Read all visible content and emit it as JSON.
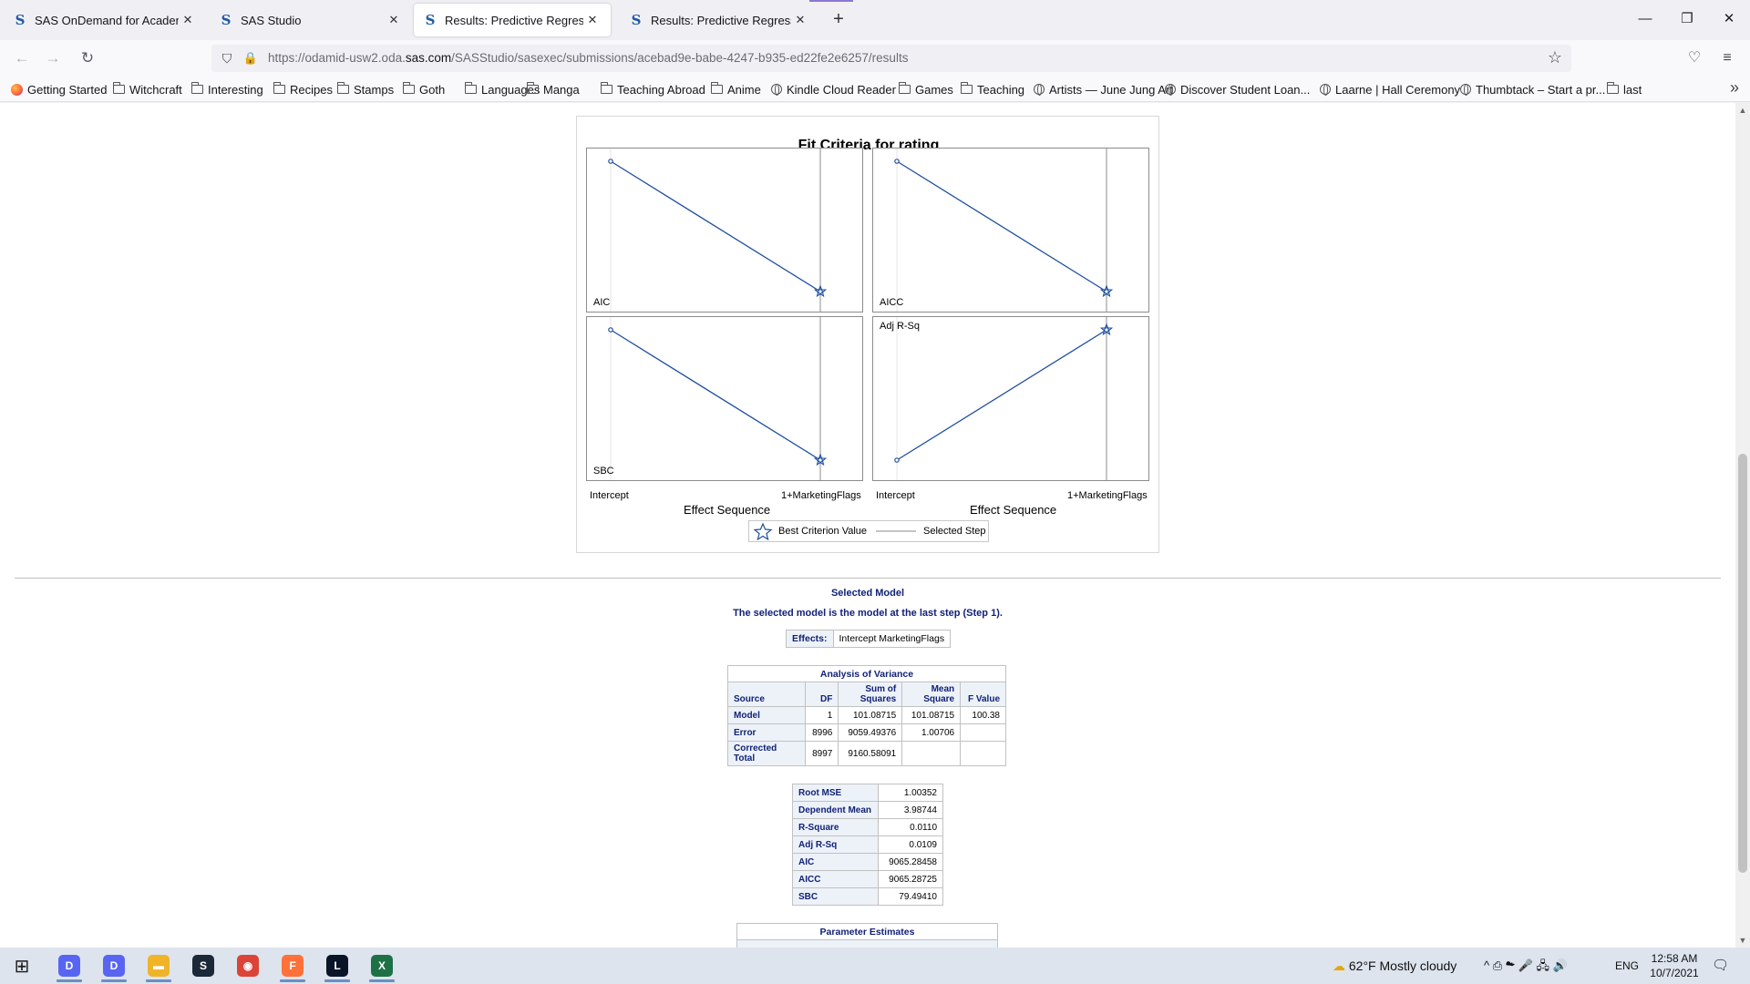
{
  "browser": {
    "tabs": [
      {
        "title": "SAS OnDemand for Academics",
        "close": "✕"
      },
      {
        "title": "SAS Studio",
        "close": "✕"
      },
      {
        "title": "Results: Predictive Regression M",
        "close": "✕"
      },
      {
        "title": "Results: Predictive Regression M",
        "close": "✕"
      }
    ],
    "favicon_glyph": "S",
    "new_tab": "+",
    "window_controls": {
      "minimize": "—",
      "restore": "❐",
      "close": "✕"
    },
    "url_host_prefix": "https://odamid-usw2.oda.",
    "url_host": "sas.com",
    "url_path": "/SASStudio/sasexec/submissions/acebad9e-babe-4247-b935-ed22fe2e6257/results",
    "nav_icons": {
      "back": "←",
      "forward": "→",
      "reload": "↻",
      "shield": "⛉",
      "lock": "🔒",
      "star": "☆",
      "pocket": "♡",
      "menu": "≡"
    },
    "bookmarks": [
      {
        "label": "Getting Started",
        "icon": "firefox-icon"
      },
      {
        "label": "Witchcraft",
        "icon": "folder-icon"
      },
      {
        "label": "Interesting",
        "icon": "folder-icon"
      },
      {
        "label": "Recipes",
        "icon": "folder-icon"
      },
      {
        "label": "Stamps",
        "icon": "folder-icon"
      },
      {
        "label": "Goth",
        "icon": "folder-icon"
      },
      {
        "label": "Languages",
        "icon": "folder-icon"
      },
      {
        "label": "Manga",
        "icon": "folder-icon"
      },
      {
        "label": "Teaching Abroad",
        "icon": "folder-icon"
      },
      {
        "label": "Anime",
        "icon": "folder-icon"
      },
      {
        "label": "Kindle Cloud Reader",
        "icon": "globe-icon"
      },
      {
        "label": "Games",
        "icon": "folder-icon"
      },
      {
        "label": "Teaching",
        "icon": "folder-icon"
      },
      {
        "label": "Artists — June Jung Art",
        "icon": "globe-icon"
      },
      {
        "label": "Discover Student Loan...",
        "icon": "globe-icon"
      },
      {
        "label": "Laarne | Hall Ceremony",
        "icon": "globe-icon"
      },
      {
        "label": "Thumbtack – Start a pr...",
        "icon": "globe-icon"
      },
      {
        "label": "last",
        "icon": "folder-icon"
      }
    ],
    "bookmarks_more": "»"
  },
  "figure": {
    "title": "Fit Criteria for rating",
    "x_label": "Effect Sequence",
    "x_ticks": [
      "Intercept",
      "1+MarketingFlags"
    ],
    "legend": {
      "best": "Best Criterion Value",
      "selected": "Selected Step"
    },
    "line_color": "#1f4f9f"
  },
  "chart_data": {
    "type": "line",
    "title": "Fit Criteria for rating",
    "xlabel": "Effect Sequence",
    "categories": [
      "Intercept",
      "1+MarketingFlags"
    ],
    "selected_step": "1+MarketingFlags",
    "series": [
      {
        "name": "AIC",
        "trend": "decreasing",
        "best_at": "1+MarketingFlags"
      },
      {
        "name": "AICC",
        "trend": "decreasing",
        "best_at": "1+MarketingFlags"
      },
      {
        "name": "SBC",
        "trend": "decreasing",
        "best_at": "1+MarketingFlags"
      },
      {
        "name": "Adj R-Sq",
        "trend": "increasing",
        "best_at": "1+MarketingFlags"
      }
    ],
    "panels": [
      {
        "label": "AIC",
        "start": "high",
        "end": "low"
      },
      {
        "label": "AICC",
        "start": "high",
        "end": "low"
      },
      {
        "label": "SBC",
        "start": "high",
        "end": "low"
      },
      {
        "label": "Adj R-Sq",
        "start": "low",
        "end": "high"
      }
    ]
  },
  "selected_model": {
    "title": "Selected Model",
    "subtitle": "The selected model is the model at the last step (Step 1).",
    "effects_label": "Effects:",
    "effects_value": "Intercept MarketingFlags"
  },
  "anova": {
    "caption": "Analysis of Variance",
    "headers": [
      "Source",
      "DF",
      "Sum of\nSquares",
      "Mean\nSquare",
      "F Value"
    ],
    "rows": [
      [
        "Model",
        "1",
        "101.08715",
        "101.08715",
        "100.38"
      ],
      [
        "Error",
        "8996",
        "9059.49376",
        "1.00706",
        ""
      ],
      [
        "Corrected Total",
        "8997",
        "9160.58091",
        "",
        ""
      ]
    ]
  },
  "fit_stats": [
    [
      "Root MSE",
      "1.00352"
    ],
    [
      "Dependent Mean",
      "3.98744"
    ],
    [
      "R-Square",
      "0.0110"
    ],
    [
      "Adj R-Sq",
      "0.0109"
    ],
    [
      "AIC",
      "9065.28458"
    ],
    [
      "AICC",
      "9065.28725"
    ],
    [
      "SBC",
      "79.49410"
    ]
  ],
  "param_estimates": {
    "caption": "Parameter Estimates"
  },
  "taskbar": {
    "start": "⊞",
    "apps": [
      {
        "name": "discord-1",
        "color": "#5865f2",
        "glyph": "D"
      },
      {
        "name": "discord-2",
        "color": "#5865f2",
        "glyph": "D"
      },
      {
        "name": "file-explorer",
        "color": "#f0b429",
        "glyph": "▬"
      },
      {
        "name": "steam",
        "color": "#1b2838",
        "glyph": "S"
      },
      {
        "name": "chrome",
        "color": "#db4437",
        "glyph": "◉"
      },
      {
        "name": "firefox",
        "color": "#ff7139",
        "glyph": "F"
      },
      {
        "name": "league",
        "color": "#0a1428",
        "glyph": "L"
      },
      {
        "name": "spreadsheet",
        "color": "#1e7145",
        "glyph": "X"
      }
    ],
    "weather": "62°F  Mostly cloudy",
    "tray_icons": "^  ⎙  ☁  🎤  🖧  🔊",
    "lang": "ENG",
    "time": "12:58 AM",
    "date": "10/7/2021",
    "notifications": "🗨"
  }
}
